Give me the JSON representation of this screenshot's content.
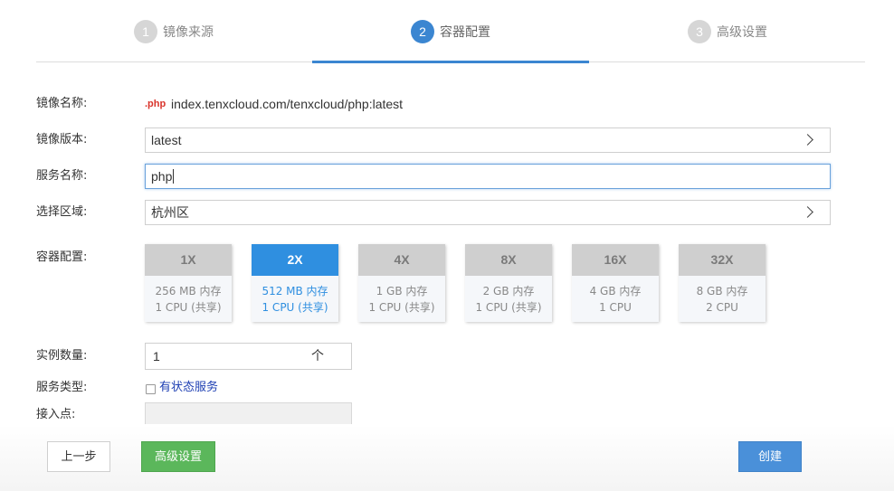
{
  "steps": [
    {
      "num": "1",
      "label": "镜像来源",
      "active": false
    },
    {
      "num": "2",
      "label": "容器配置",
      "active": true
    },
    {
      "num": "3",
      "label": "高级设置",
      "active": false
    }
  ],
  "form": {
    "image_name_label": "镜像名称:",
    "image_tag": ".php",
    "image_url": "index.tenxcloud.com/tenxcloud/php:latest",
    "image_version_label": "镜像版本:",
    "image_version_value": "latest",
    "service_name_label": "服务名称:",
    "service_name_value": "php",
    "region_label": "选择区域:",
    "region_value": "杭州区",
    "container_config_label": "容器配置:",
    "instance_count_label": "实例数量:",
    "instance_count_value": "1",
    "instance_count_unit": "个",
    "service_type_label": "服务类型:",
    "stateful_label": "有状态服务",
    "endpoint_label": "接入点:"
  },
  "sizes": [
    {
      "name": "1X",
      "memory": "256 MB 内存",
      "cpu": "1 CPU (共享)",
      "selected": false
    },
    {
      "name": "2X",
      "memory": "512 MB 内存",
      "cpu": "1 CPU (共享)",
      "selected": true
    },
    {
      "name": "4X",
      "memory": "1 GB 内存",
      "cpu": "1 CPU (共享)",
      "selected": false
    },
    {
      "name": "8X",
      "memory": "2 GB 内存",
      "cpu": "1 CPU (共享)",
      "selected": false
    },
    {
      "name": "16X",
      "memory": "4 GB 内存",
      "cpu": "1 CPU",
      "selected": false
    },
    {
      "name": "32X",
      "memory": "8 GB 内存",
      "cpu": "2 CPU",
      "selected": false
    }
  ],
  "buttons": {
    "prev": "上一步",
    "advanced": "高级设置",
    "create": "创建"
  },
  "colors": {
    "active_step": "#3b86d1",
    "selected_card": "#2f8fe0",
    "advanced_button": "#5bb75b",
    "create_button": "#4a90d9",
    "php_tag": "#d9342b"
  }
}
